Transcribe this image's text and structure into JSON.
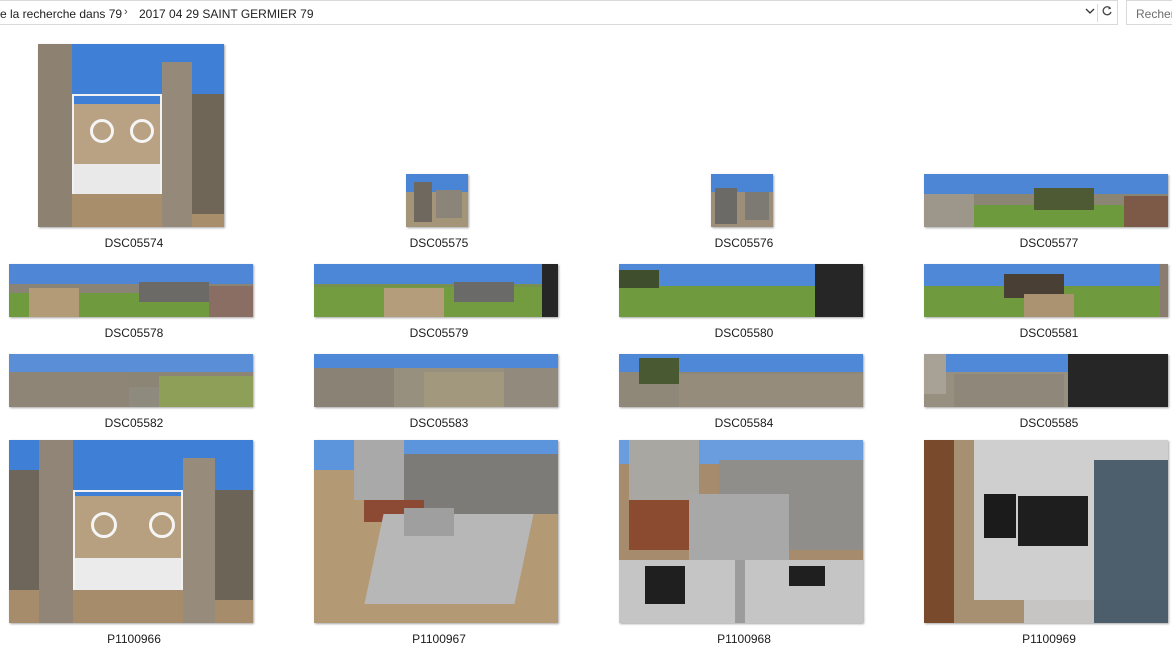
{
  "address_bar": {
    "crumb_parent": "e la recherche dans 79",
    "crumb_separator": "›",
    "crumb_current": "2017 04 29 SAINT GERMIER 79",
    "dropdown_icon": "chevron-down-icon",
    "refresh_icon": "refresh-icon"
  },
  "search": {
    "placeholder": "Recher"
  },
  "files": [
    {
      "name": "DSC05574"
    },
    {
      "name": "DSC05575"
    },
    {
      "name": "DSC05576"
    },
    {
      "name": "DSC05577"
    },
    {
      "name": "DSC05578"
    },
    {
      "name": "DSC05579"
    },
    {
      "name": "DSC05580"
    },
    {
      "name": "DSC05581"
    },
    {
      "name": "DSC05582"
    },
    {
      "name": "DSC05583"
    },
    {
      "name": "DSC05584"
    },
    {
      "name": "DSC05585"
    },
    {
      "name": "P1100966"
    },
    {
      "name": "P1100967"
    },
    {
      "name": "P1100968"
    },
    {
      "name": "P1100969"
    }
  ],
  "colors": {
    "sky": "#4f86d6",
    "grass": "#6f9a3e",
    "gravel": "#b49a78",
    "stone": "#9a9388",
    "dark": "#262626"
  }
}
